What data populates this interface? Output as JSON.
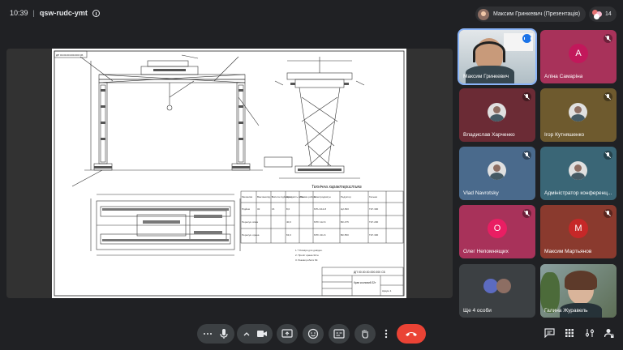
{
  "topbar": {
    "time": "10:39",
    "separator": "|",
    "meeting_code": "qsw-rudc-ymt",
    "presenter_chip": "Максим Гринкевич (Презентація)",
    "participant_count": "14"
  },
  "slide": {
    "stamp_top": "ДП 00.00.00.000.000 СБ",
    "table_title": "Технічна характеристика",
    "table_headers": [
      "Механізм",
      "Вантажопід. т",
      "Висота підйому м",
      "Швидкість м/хв",
      "Режим роботи",
      "Електродвигун",
      "Редуктор",
      "Гальмо"
    ],
    "table_rows": [
      [
        "Підйом",
        "32",
        "16",
        "8,0",
        "",
        "МТН 412-8",
        "Ц2-500",
        "ТКГ-300"
      ],
      [
        "Пересув. візка",
        "",
        "",
        "40,0",
        "",
        "МТF 112-6",
        "ВК-475",
        "ТКГ-200"
      ],
      [
        "Пересув. крана",
        "",
        "",
        "63,0",
        "",
        "МТF 211-6",
        "ВК-550",
        "ТКГ-300"
      ]
    ],
    "notes": [
      "1.* Розміри для довідок.",
      "2. Проліт крана 32 м.",
      "3. Режим роботи 6К."
    ],
    "stamp_code": "ДП 00.00.00.000.000 СБ",
    "stamp_name": "Кран козловий 32т",
    "stamp_sheet": "Аркуш 1"
  },
  "participants": [
    {
      "name": "Максим Гринкевич",
      "status": "speaking",
      "type": "video"
    },
    {
      "name": "Аліна Самаріна",
      "status": "muted",
      "letter": "А",
      "color": "#c2185b",
      "bg": "#a8325a"
    },
    {
      "name": "Владислав Харченко",
      "status": "muted",
      "type": "photo",
      "bg": "#6b2b35"
    },
    {
      "name": "Ігор Кутняшенко",
      "status": "muted",
      "type": "photo",
      "bg": "#6e5a2e"
    },
    {
      "name": "Vlad Navrotsky",
      "status": "muted",
      "type": "photo",
      "bg": "#4a6a8c"
    },
    {
      "name": "Адміністратор конференц...",
      "status": "muted",
      "type": "photo",
      "bg": "#3a6676"
    },
    {
      "name": "Олег Непомнящих",
      "status": "muted",
      "letter": "О",
      "color": "#e91e63",
      "bg": "#a8325a"
    },
    {
      "name": "Максим Мартьянов",
      "status": "muted",
      "letter": "М",
      "color": "#c62828",
      "bg": "#8a3a2e"
    },
    {
      "name": "Ще 4 особи",
      "status": "",
      "type": "group",
      "bg": "#3c4043"
    },
    {
      "name": "Галина Журавель",
      "status": "",
      "type": "video"
    }
  ],
  "icons": {
    "info": "info-icon",
    "more": "more-options-icon",
    "mic": "microphone-icon",
    "chevron": "chevron-up-icon",
    "camera": "camera-icon",
    "present": "present-screen-icon",
    "emoji": "emoji-icon",
    "captions": "captions-icon",
    "hand": "raise-hand-icon",
    "leave": "leave-call-icon",
    "chat": "chat-icon",
    "activities": "activities-icon",
    "host": "host-controls-icon"
  },
  "colors": {
    "background": "#202124",
    "toolbar_button": "#3c4043",
    "leave_button": "#ea4335",
    "speaking_indicator": "#1a73e8"
  }
}
